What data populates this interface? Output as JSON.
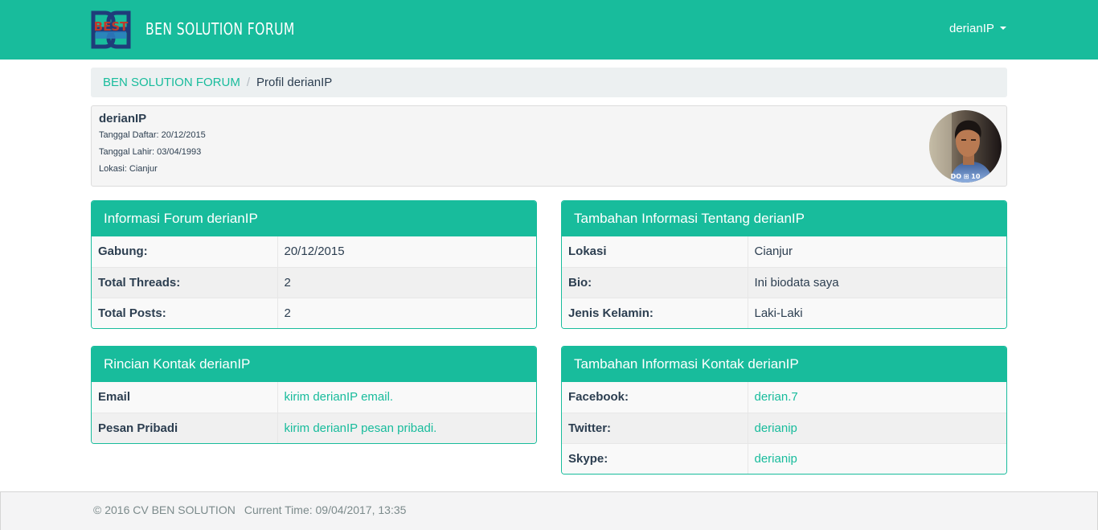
{
  "navbar": {
    "logo_text": "BEST",
    "brand": "BEN SOLUTION FORUM",
    "user": "derianIP"
  },
  "breadcrumb": {
    "home": "BEN SOLUTION FORUM",
    "current": "Profil derianIP"
  },
  "profile": {
    "name": "derianIP",
    "registered": "Tanggal Daftar: 20/12/2015",
    "birthdate": "Tanggal Lahir: 03/04/1993",
    "location": "Lokasi: Cianjur",
    "avatar_caption": "DO ⊞ 10"
  },
  "forum_info": {
    "title": "Informasi Forum derianIP",
    "rows": [
      {
        "label": "Gabung:",
        "value": "20/12/2015"
      },
      {
        "label": "Total Threads:",
        "value": "2"
      },
      {
        "label": "Total Posts:",
        "value": "2"
      }
    ]
  },
  "extra_info": {
    "title": "Tambahan Informasi Tentang derianIP",
    "rows": [
      {
        "label": "Lokasi",
        "value": "Cianjur"
      },
      {
        "label": "Bio:",
        "value": "Ini biodata saya"
      },
      {
        "label": "Jenis Kelamin:",
        "value": "Laki-Laki"
      }
    ]
  },
  "contact": {
    "title": "Rincian Kontak derianIP",
    "rows": [
      {
        "label": "Email",
        "value": "kirim derianIP email."
      },
      {
        "label": "Pesan Pribadi",
        "value": "kirim derianIP pesan pribadi."
      }
    ]
  },
  "extra_contact": {
    "title": "Tambahan Informasi Kontak derianIP",
    "rows": [
      {
        "label": "Facebook:",
        "value": "derian.7"
      },
      {
        "label": "Twitter:",
        "value": "derianip"
      },
      {
        "label": "Skype:",
        "value": "derianip"
      }
    ]
  },
  "footer": {
    "copyright": "© 2016 CV BEN SOLUTION",
    "time": "Current Time: 09/04/2017, 13:35"
  },
  "colors": {
    "accent": "#18bc9c",
    "text": "#2c3e50",
    "breadcrumb_bg": "#ecf0f1",
    "footer_text": "#7b8a8b"
  },
  "icons": [
    "logo-icon",
    "caret-down-icon",
    "avatar-image"
  ]
}
